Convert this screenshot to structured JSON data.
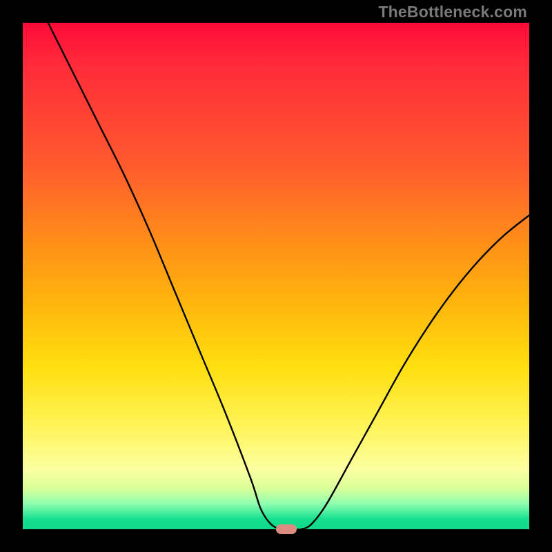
{
  "watermark": "TheBottleneck.com",
  "colors": {
    "curve": "#000000",
    "marker": "#dd8b7e",
    "gradient_top": "#ff0a3a",
    "gradient_bottom": "#0fd98a"
  },
  "chart_data": {
    "type": "line",
    "title": "",
    "xlabel": "",
    "ylabel": "",
    "xlim": [
      0,
      100
    ],
    "ylim": [
      0,
      100
    ],
    "grid": false,
    "legend": false,
    "series": [
      {
        "name": "curve",
        "x": [
          5,
          10,
          15,
          20,
          25,
          30,
          35,
          40,
          45,
          47,
          49,
          51,
          53,
          55,
          57,
          60,
          65,
          70,
          75,
          80,
          85,
          90,
          95,
          100
        ],
        "y": [
          100,
          90,
          80,
          70,
          59,
          47,
          35,
          23,
          10,
          4,
          1,
          0,
          0,
          0,
          1,
          5,
          14,
          23,
          32,
          40,
          47,
          53,
          58,
          62
        ]
      }
    ],
    "marker": {
      "x": 52,
      "y": 0
    },
    "notes": "Background encodes bottleneck severity: red (bad) at top through yellow to green (good) at bottom. Curve shape is read from pixels; numeric values are approximate percentages along each axis."
  }
}
